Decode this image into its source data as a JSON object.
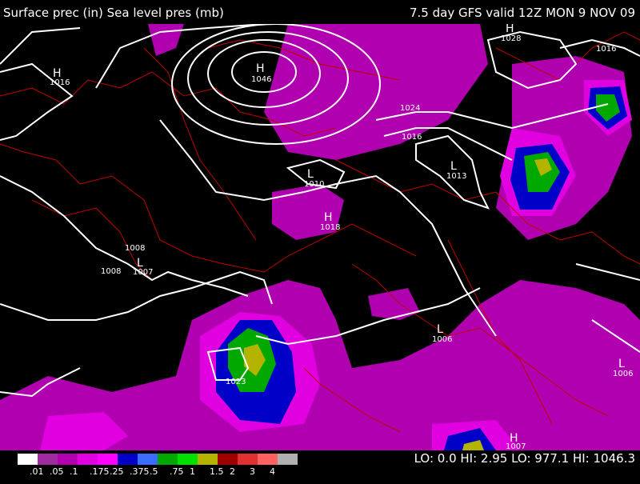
{
  "header": {
    "left_title": "Surface prec (in) Sea level pres (mb)",
    "right_title": "7.5 day GFS valid 12Z MON 9 NOV 09"
  },
  "legend": {
    "ticks": [
      ".01",
      ".05",
      ".1",
      ".175",
      ".25",
      ".375",
      ".5",
      ".75",
      "1",
      "1.5",
      "2",
      "3",
      "4"
    ],
    "colors": [
      "#ffffff",
      "#a02aa0",
      "#b000b0",
      "#e000e0",
      "#ff00ff",
      "#0000c8",
      "#3c6cff",
      "#00a800",
      "#00e000",
      "#b4b400",
      "#a00000",
      "#e03030",
      "#ff6060",
      "#b0b0b0"
    ]
  },
  "stats": {
    "text": "LO:   0.0  HI: 2.95  LO: 977.1  HI: 1046.3"
  },
  "map_labels": {
    "h1": "H",
    "p1": "1016",
    "h2": "H",
    "p2": "1046",
    "h3": "H",
    "p3": "1028",
    "p4": "1016",
    "p5": "1024",
    "p6": "1016",
    "l1": "L",
    "p7": "1013",
    "l2": "L",
    "p8": "1010",
    "h4": "H",
    "p9": "1018",
    "p10": "1008",
    "p11": "1008",
    "l3": "L",
    "p12": "1007",
    "l4": "L",
    "p13": "1006",
    "l5": "L",
    "p14": "1006",
    "p15": "1023",
    "h5": "H",
    "p16": "1007"
  }
}
